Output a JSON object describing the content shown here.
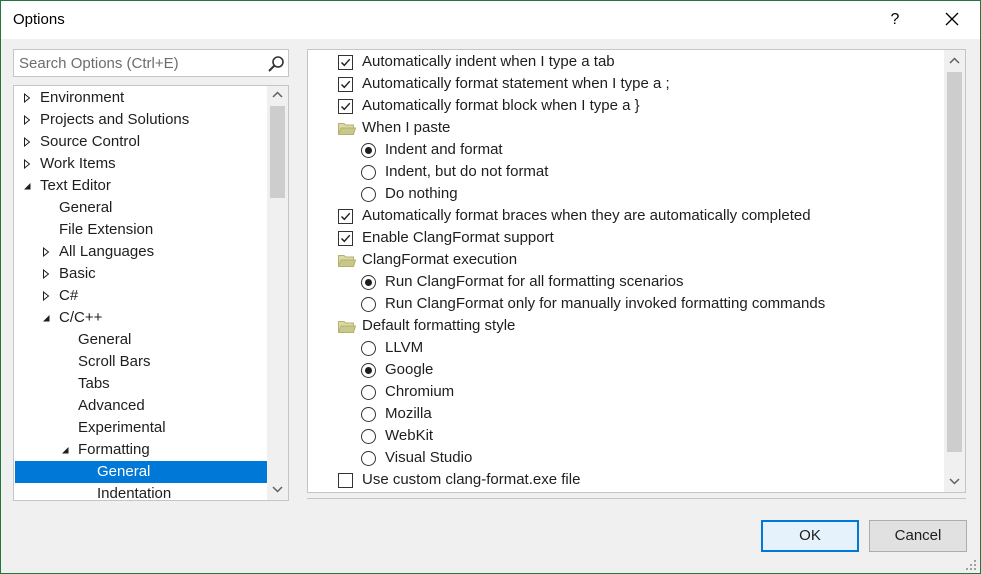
{
  "window": {
    "title": "Options",
    "help_label": "?"
  },
  "search": {
    "placeholder": "Search Options (Ctrl+E)"
  },
  "tree": {
    "items": [
      {
        "label": "Environment",
        "level": 0,
        "arrow": "collapsed"
      },
      {
        "label": "Projects and Solutions",
        "level": 0,
        "arrow": "collapsed"
      },
      {
        "label": "Source Control",
        "level": 0,
        "arrow": "collapsed"
      },
      {
        "label": "Work Items",
        "level": 0,
        "arrow": "collapsed"
      },
      {
        "label": "Text Editor",
        "level": 0,
        "arrow": "expanded"
      },
      {
        "label": "General",
        "level": 1,
        "arrow": "none"
      },
      {
        "label": "File Extension",
        "level": 1,
        "arrow": "none"
      },
      {
        "label": "All Languages",
        "level": 1,
        "arrow": "collapsed"
      },
      {
        "label": "Basic",
        "level": 1,
        "arrow": "collapsed"
      },
      {
        "label": "C#",
        "level": 1,
        "arrow": "collapsed"
      },
      {
        "label": "C/C++",
        "level": 1,
        "arrow": "expanded"
      },
      {
        "label": "General",
        "level": 2,
        "arrow": "none"
      },
      {
        "label": "Scroll Bars",
        "level": 2,
        "arrow": "none"
      },
      {
        "label": "Tabs",
        "level": 2,
        "arrow": "none"
      },
      {
        "label": "Advanced",
        "level": 2,
        "arrow": "none"
      },
      {
        "label": "Experimental",
        "level": 2,
        "arrow": "none"
      },
      {
        "label": "Formatting",
        "level": 2,
        "arrow": "expanded"
      },
      {
        "label": "General",
        "level": 3,
        "arrow": "none",
        "selected": true
      },
      {
        "label": "Indentation",
        "level": 3,
        "arrow": "none"
      }
    ]
  },
  "options": [
    {
      "type": "checkbox",
      "checked": true,
      "indent": 0,
      "label": "Automatically indent when I type a tab"
    },
    {
      "type": "checkbox",
      "checked": true,
      "indent": 0,
      "label": "Automatically format statement when I type a ;"
    },
    {
      "type": "checkbox",
      "checked": true,
      "indent": 0,
      "label": "Automatically format block when I type a }"
    },
    {
      "type": "group",
      "indent": 0,
      "label": "When I paste"
    },
    {
      "type": "radio",
      "checked": true,
      "indent": 1,
      "label": "Indent and format"
    },
    {
      "type": "radio",
      "checked": false,
      "indent": 1,
      "label": "Indent, but do not format"
    },
    {
      "type": "radio",
      "checked": false,
      "indent": 1,
      "label": "Do nothing"
    },
    {
      "type": "checkbox",
      "checked": true,
      "indent": 0,
      "label": "Automatically format braces when they are automatically completed"
    },
    {
      "type": "checkbox",
      "checked": true,
      "indent": 0,
      "label": "Enable ClangFormat support"
    },
    {
      "type": "group",
      "indent": 0,
      "label": "ClangFormat execution"
    },
    {
      "type": "radio",
      "checked": true,
      "indent": 1,
      "label": "Run ClangFormat for all formatting scenarios"
    },
    {
      "type": "radio",
      "checked": false,
      "indent": 1,
      "label": "Run ClangFormat only for manually invoked formatting commands"
    },
    {
      "type": "group",
      "indent": 0,
      "label": "Default formatting style"
    },
    {
      "type": "radio",
      "checked": false,
      "indent": 1,
      "label": "LLVM"
    },
    {
      "type": "radio",
      "checked": true,
      "indent": 1,
      "label": "Google"
    },
    {
      "type": "radio",
      "checked": false,
      "indent": 1,
      "label": "Chromium"
    },
    {
      "type": "radio",
      "checked": false,
      "indent": 1,
      "label": "Mozilla"
    },
    {
      "type": "radio",
      "checked": false,
      "indent": 1,
      "label": "WebKit"
    },
    {
      "type": "radio",
      "checked": false,
      "indent": 1,
      "label": "Visual Studio"
    },
    {
      "type": "checkbox",
      "checked": false,
      "indent": 0,
      "label": "Use custom clang-format.exe file"
    }
  ],
  "buttons": {
    "ok_label": "OK",
    "cancel_label": "Cancel"
  },
  "colors": {
    "selection": "#0078d7",
    "window_border": "#1f7a3a",
    "folder": "#c8c88a"
  }
}
